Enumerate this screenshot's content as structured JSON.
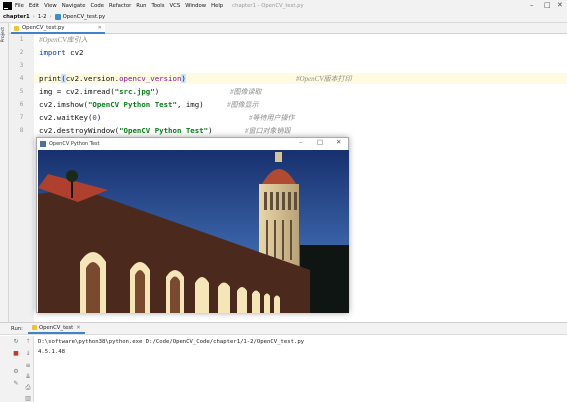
{
  "menubar": {
    "items": [
      "File",
      "Edit",
      "View",
      "Navigate",
      "Code",
      "Refactor",
      "Run",
      "Tools",
      "VCS",
      "Window",
      "Help"
    ],
    "window_title": "chapter1 - OpenCV_test.py"
  },
  "breadcrumb": {
    "project": "chapter1",
    "folder": "1-2",
    "file": "OpenCV_test.py"
  },
  "sidebar": {
    "label": "Project"
  },
  "editor_tab": {
    "label": "OpenCV_test.py"
  },
  "editor": {
    "line_numbers": [
      "1",
      "2",
      "3",
      "4",
      "5",
      "6",
      "7",
      "8"
    ],
    "line1_comment": "#OpenCV库引入",
    "line2_kw": "import",
    "line2_mod": " cv2",
    "line4_a": "print",
    "line4_b": "(",
    "line4_c": "cv2.version.",
    "line4_d": "opencv_version",
    "line4_e": ")",
    "line4_comment": "#OpenCV版本打印",
    "line5_a": "img = cv2.imread(",
    "line5_str": "\"src.jpg\"",
    "line5_b": ")",
    "line5_comment": "#图像读取",
    "line6_a": "cv2.imshow(",
    "line6_str": "\"OpenCV Python Test\"",
    "line6_b": ", img)",
    "line6_comment": "#图像显示",
    "line7_a": "cv2.waitKey(",
    "line7_num": "0",
    "line7_b": ")",
    "line7_comment": "#等待用户操作",
    "line8_a": "cv2.destroyWindow(",
    "line8_str": "\"OpenCV Python Test\"",
    "line8_b": ")",
    "line8_comment": "#窗口对象销毁"
  },
  "image_window": {
    "title": "OpenCV Python Test"
  },
  "run_panel": {
    "label": "Run:",
    "tab": "OpenCV_test",
    "console_lines": [
      "D:\\software\\python38\\python.exe D:/Code/OpenCV_Code/chapter1/1-2/OpenCV_test.py",
      "4.5.1.48"
    ]
  },
  "colors": {
    "accent": "#4083c9",
    "keyword": "#0033b3",
    "string": "#067d17"
  }
}
